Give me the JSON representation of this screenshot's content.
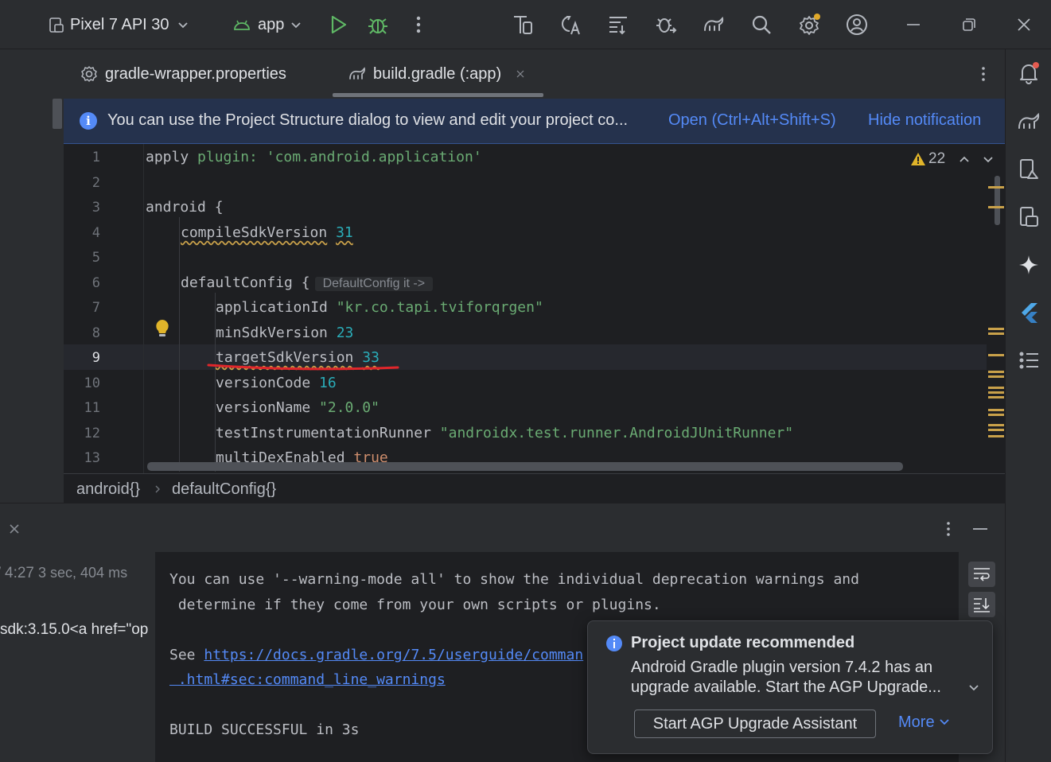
{
  "toolbar": {
    "device": "Pixel 7 API 30",
    "run_config": "app"
  },
  "tabs": [
    {
      "label": "gradle-wrapper.properties",
      "active": false
    },
    {
      "label": "build.gradle (:app)",
      "active": true
    }
  ],
  "banner": {
    "message": "You can use the Project Structure dialog to view and edit your project co...",
    "open_link": "Open (Ctrl+Alt+Shift+S)",
    "hide_link": "Hide notification"
  },
  "editor": {
    "warnings_count": "22",
    "line_numbers": [
      "1",
      "2",
      "3",
      "4",
      "5",
      "6",
      "7",
      "8",
      "9",
      "10",
      "11",
      "12",
      "13"
    ],
    "current_line": "9",
    "code": {
      "l1_a": "apply ",
      "l1_b": "plugin: ",
      "l1_c": "'com.android.application'",
      "l3": "android {",
      "l4_a": "compileSdkVersion",
      "l4_b": "31",
      "l6_a": "defaultConfig {",
      "l6_hint": "DefaultConfig it ->",
      "l7_a": "applicationId ",
      "l7_b": "\"kr.co.tapi.tviforqrgen\"",
      "l8_a": "minSdkVersion ",
      "l8_b": "23",
      "l9_a": "targetSdkVersion",
      "l9_b": "33",
      "l10_a": "versionCode ",
      "l10_b": "16",
      "l11_a": "versionName ",
      "l11_b": "\"2.0.0\"",
      "l12_a": "testInstrumentationRunner ",
      "l12_b": "\"androidx.test.runner.AndroidJUnitRunner\"",
      "l13_a": "multiDexEnabled ",
      "l13_b": "true"
    }
  },
  "breadcrumb": {
    "items": [
      "android{}",
      "defaultConfig{}"
    ]
  },
  "build_panel": {
    "time": "4:27",
    "duration": "3 sec, 404 ms",
    "tree_text": "sdk:3.15.0<a href=\"op"
  },
  "console": {
    "line1": "You can use '--warning-mode all' to show the individual deprecation warnings and",
    "line2": " determine if they come from your own scripts or plugins.",
    "line3_prefix": "See ",
    "line3_link": "https://docs.gradle.org/7.5/userguide/comman",
    "line4_link": " .html#sec:command_line_warnings",
    "line5": "BUILD SUCCESSFUL in 3s"
  },
  "popup": {
    "title": "Project update recommended",
    "body": "Android Gradle plugin version 7.4.2 has an upgrade available. Start the AGP Upgrade...",
    "button": "Start AGP Upgrade Assistant",
    "more": "More"
  },
  "colors": {
    "accent": "#548af7",
    "warning": "#c9a14a",
    "run_green": "#5fb865",
    "annotation_red": "#e0262b"
  }
}
